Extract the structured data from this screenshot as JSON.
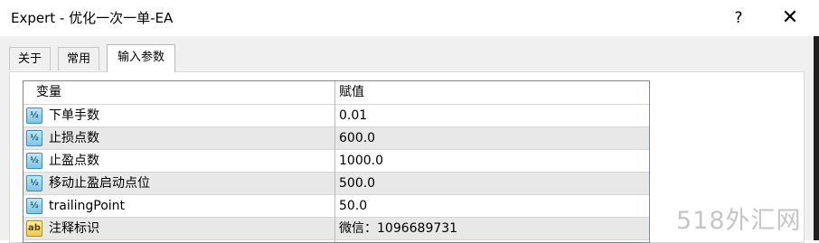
{
  "window": {
    "title": "Expert - 优化一次一单-EA",
    "help_label": "?",
    "close_label": "✕"
  },
  "tabs": [
    {
      "label": "关于"
    },
    {
      "label": "常用"
    },
    {
      "label": "输入参数"
    }
  ],
  "table": {
    "headers": {
      "variable": "变量",
      "value": "赋值"
    },
    "rows": [
      {
        "icon": "½",
        "name": "下单手数",
        "value": "0.01"
      },
      {
        "icon": "½",
        "name": "止损点数",
        "value": "600.0"
      },
      {
        "icon": "½",
        "name": "止盈点数",
        "value": "1000.0"
      },
      {
        "icon": "½",
        "name": "移动止盈启动点位",
        "value": "500.0"
      },
      {
        "icon": "½",
        "name": "trailingPoint",
        "value": "50.0"
      },
      {
        "icon": "ab",
        "name": "注释标识",
        "value": "微信：1096689731"
      }
    ]
  },
  "watermark": "518外汇网"
}
